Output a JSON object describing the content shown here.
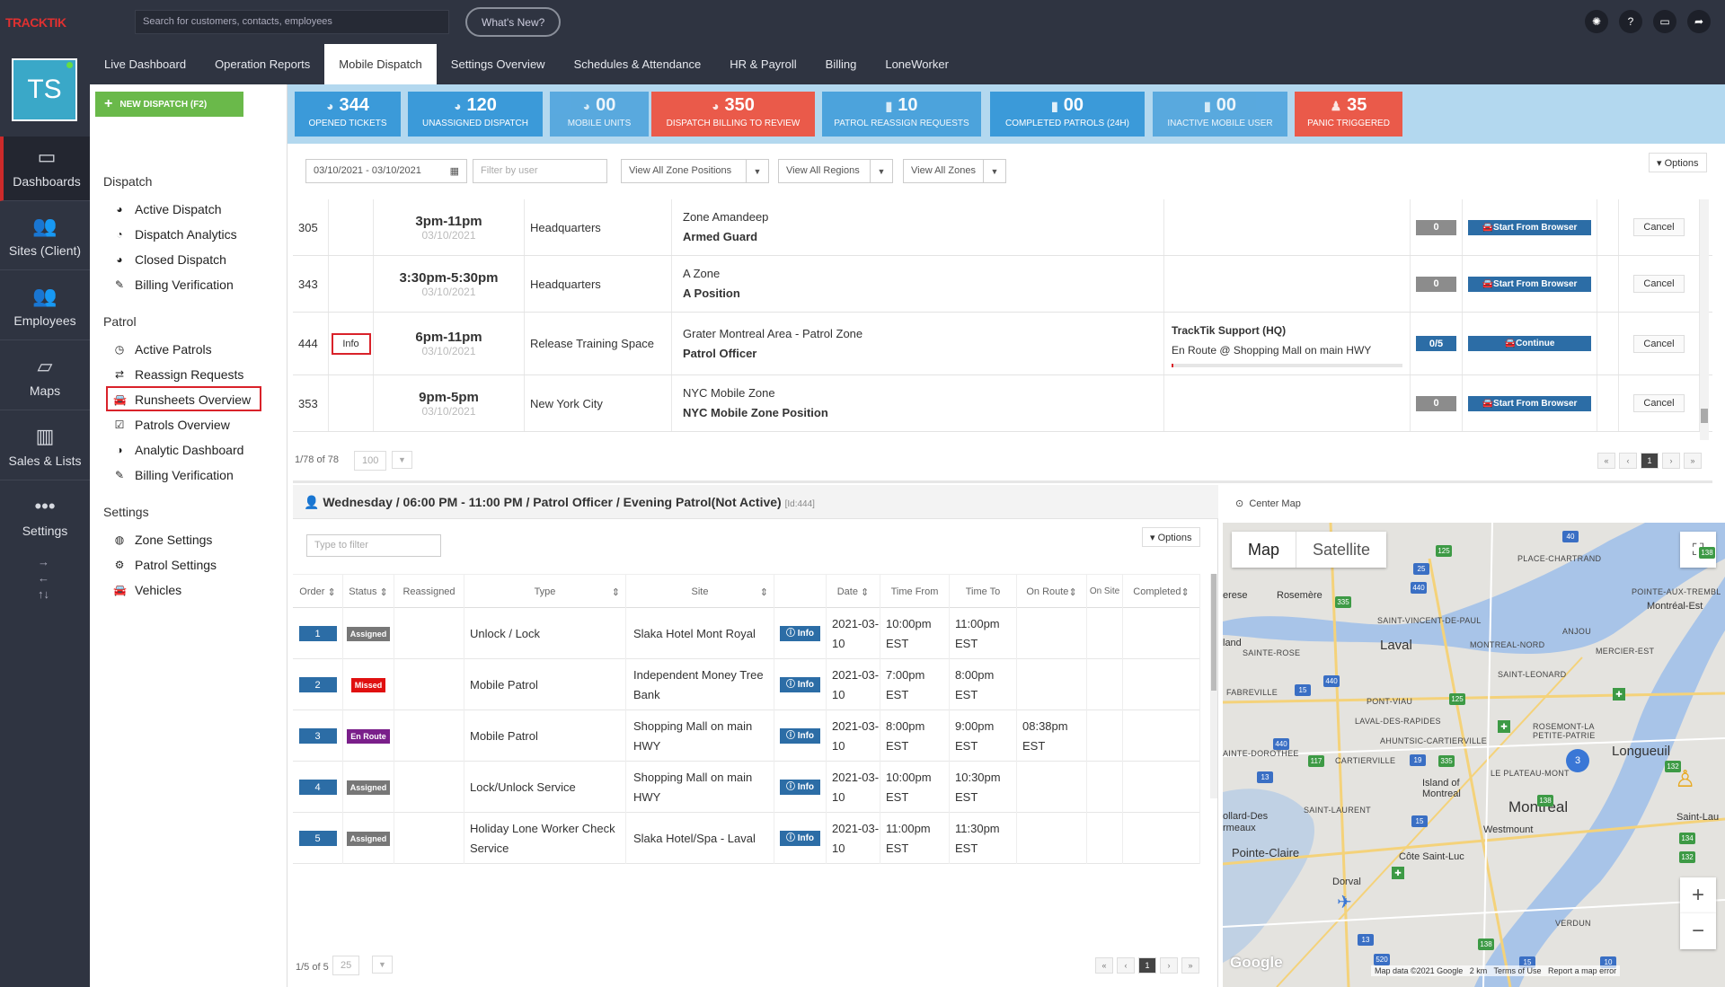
{
  "topbar": {
    "logo_a": "TRACK",
    "logo_b": "TIK",
    "search_placeholder": "Search for customers, contacts, employees",
    "whats_new": "What's New?",
    "icons": [
      "bulb-icon",
      "help-icon",
      "monitor-icon",
      "share-icon"
    ],
    "help_glyph": "?"
  },
  "nav_tabs": [
    "Live Dashboard",
    "Operation Reports",
    "Mobile Dispatch",
    "Settings Overview",
    "Schedules & Attendance",
    "HR & Payroll",
    "Billing",
    "LoneWorker"
  ],
  "active_tab": "Mobile Dispatch",
  "avatar": {
    "initials": "TS"
  },
  "left_nav": [
    {
      "label": "Dashboards",
      "icon": "monitor-icon"
    },
    {
      "label": "Sites (Client)",
      "icon": "people-icon"
    },
    {
      "label": "Employees",
      "icon": "employees-icon"
    },
    {
      "label": "Maps",
      "icon": "map-icon"
    },
    {
      "label": "Sales & Lists",
      "icon": "bar-chart-icon"
    },
    {
      "label": "Settings",
      "icon": "dots-icon"
    }
  ],
  "new_dispatch": "NEW DISPATCH (F2)",
  "sidebar": {
    "dispatch_header": "Dispatch",
    "dispatch_items": [
      "Active Dispatch",
      "Dispatch Analytics",
      "Closed Dispatch",
      "Billing Verification"
    ],
    "patrol_header": "Patrol",
    "patrol_items": [
      "Active Patrols",
      "Reassign Requests",
      "Runsheets Overview",
      "Patrols Overview",
      "Analytic Dashboard",
      "Billing Verification"
    ],
    "settings_header": "Settings",
    "settings_items": [
      "Zone Settings",
      "Patrol Settings",
      "Vehicles"
    ]
  },
  "stats": [
    {
      "value": "344",
      "label": "OPENED TICKETS",
      "color": "#3b9ad9"
    },
    {
      "value": "120",
      "label": "UNASSIGNED DISPATCH",
      "color": "#3b9ad9"
    },
    {
      "value": "00",
      "label": "MOBILE UNITS",
      "color": "#3b9ad9"
    },
    {
      "value": "350",
      "label": "DISPATCH BILLING TO REVIEW",
      "color": "#ea5a4a"
    },
    {
      "value": "10",
      "label": "PATROL REASSIGN REQUESTS",
      "color": "#3b9ad9"
    },
    {
      "value": "00",
      "label": "COMPLETED PATROLS (24H)",
      "color": "#3b9ad9"
    },
    {
      "value": "00",
      "label": "INACTIVE MOBILE USER",
      "color": "#3b9ad9"
    },
    {
      "value": "35",
      "label": "PANIC TRIGGERED",
      "color": "#ea5a4a"
    }
  ],
  "filters": {
    "date_range": "03/10/2021 - 03/10/2021",
    "user_placeholder": "Filter by user",
    "zone_positions": "View All Zone Positions",
    "regions": "View All Regions",
    "zones": "View All Zones",
    "options": "Options"
  },
  "patrols": [
    {
      "id": "305",
      "time": "3pm-11pm",
      "date": "03/10/2021",
      "site": "Headquarters",
      "zone": "Zone Amandeep",
      "position": "Armed Guard",
      "assignee": "",
      "status": "",
      "progress": "0",
      "action": "Start From Browser",
      "cancel": "Cancel"
    },
    {
      "id": "343",
      "time": "3:30pm-5:30pm",
      "date": "03/10/2021",
      "site": "Headquarters",
      "zone": "A Zone",
      "position": "A Position",
      "assignee": "",
      "status": "",
      "progress": "0",
      "action": "Start From Browser",
      "cancel": "Cancel"
    },
    {
      "id": "444",
      "info": "Info",
      "time": "6pm-11pm",
      "date": "03/10/2021",
      "site": "Release Training Space",
      "zone": "Grater Montreal Area - Patrol Zone",
      "position": "Patrol Officer",
      "assignee": "TrackTik Support (HQ)",
      "status": "En Route @ Shopping Mall on main HWY",
      "progress": "0/5",
      "action": "Continue",
      "cancel": "Cancel"
    },
    {
      "id": "353",
      "time": "9pm-5pm",
      "date": "03/10/2021",
      "site": "New York City",
      "zone": "NYC Mobile Zone",
      "position": "NYC Mobile Zone Position",
      "assignee": "",
      "status": "",
      "progress": "0",
      "action": "Start From Browser",
      "cancel": "Cancel"
    }
  ],
  "pager_top": {
    "count": "1/78 of 78",
    "per_page": "100",
    "page": "1"
  },
  "runsheet": {
    "title": "Wednesday / 06:00 PM - 11:00 PM / Patrol Officer / Evening Patrol(Not Active)",
    "id_tag": "[Id:444]",
    "filter_placeholder": "Type to filter",
    "options": "Options",
    "headers": [
      "Order",
      "Status",
      "Reassigned",
      "Type",
      "Site",
      "",
      "Date",
      "Time From",
      "Time To",
      "On Route",
      "On Site",
      "Completed"
    ],
    "rows": [
      {
        "order": "1",
        "status": "Assigned",
        "status_color": "#777777",
        "type": "Unlock / Lock",
        "site_a": "Slaka Hotel Mont Royal",
        "site_b": "",
        "info": "Info",
        "date_a": "2021-03-",
        "date_b": "10",
        "from_a": "10:00pm",
        "from_b": "EST",
        "to_a": "11:00pm",
        "to_b": "EST",
        "route_a": "",
        "route_b": ""
      },
      {
        "order": "2",
        "status": "Missed",
        "status_color": "#e01010",
        "type": "Mobile Patrol",
        "site_a": "Independent Money Tree",
        "site_b": "Bank",
        "info": "Info",
        "date_a": "2021-03-",
        "date_b": "10",
        "from_a": "7:00pm",
        "from_b": "EST",
        "to_a": "8:00pm",
        "to_b": "EST",
        "route_a": "",
        "route_b": ""
      },
      {
        "order": "3",
        "status": "En Route",
        "status_color": "#7a1f8a",
        "type": "Mobile Patrol",
        "site_a": "Shopping Mall on main",
        "site_b": "HWY",
        "info": "Info",
        "date_a": "2021-03-",
        "date_b": "10",
        "from_a": "8:00pm",
        "from_b": "EST",
        "to_a": "9:00pm",
        "to_b": "EST",
        "route_a": "08:38pm",
        "route_b": "EST"
      },
      {
        "order": "4",
        "status": "Assigned",
        "status_color": "#777777",
        "type": "Lock/Unlock Service",
        "site_a": "Shopping Mall on main",
        "site_b": "HWY",
        "info": "Info",
        "date_a": "2021-03-",
        "date_b": "10",
        "from_a": "10:00pm",
        "from_b": "EST",
        "to_a": "10:30pm",
        "to_b": "EST",
        "route_a": "",
        "route_b": ""
      },
      {
        "order": "5",
        "status": "Assigned",
        "status_color": "#777777",
        "type": "Holiday Lone Worker Check",
        "type_b": "Service",
        "site_a": "Slaka Hotel/Spa - Laval",
        "site_b": "",
        "info": "Info",
        "date_a": "2021-03-",
        "date_b": "10",
        "from_a": "11:00pm",
        "from_b": "EST",
        "to_a": "11:30pm",
        "to_b": "EST",
        "route_a": "",
        "route_b": ""
      }
    ],
    "pager": {
      "count": "1/5 of 5",
      "per_page": "25",
      "page": "1"
    }
  },
  "map": {
    "center_label": "Center Map",
    "tab_map": "Map",
    "tab_satellite": "Satellite",
    "cluster_count": "3",
    "labels_big": [
      "Laval",
      "Longueuil",
      "Montreal",
      "Pointe-Claire",
      "Rosemère",
      "Island of",
      "Montreal",
      "Côte Saint-Luc",
      "Westmount",
      "Dorval",
      "Montréal-Est",
      "Saint-Lau"
    ],
    "labels_caps": [
      "PLACE-CHARTRAND",
      "POINTE-AUX-TREMBL",
      "SAINT-VINCENT-DE-PAUL",
      "ANJOU",
      "MONTREAL-NORD",
      "MERCIER-EST",
      "SAINTE-ROSE",
      "SAINT-LEONARD",
      "FABREVILLE",
      "PONT-VIAU",
      "LAVAL-DES-RAPIDES",
      "ROSEMONT-LA PETITE-PATRIE",
      "AHUNTSIC-CARTIERVILLE",
      "AINTE-DOROTHEE",
      "CARTIERVILLE",
      "LE PLATEAU-MONT",
      "SAINT-LAURENT",
      "VERDUN"
    ],
    "labels_small": [
      "erese",
      "land",
      "ollard-Des",
      "rmeaux"
    ],
    "footer": "Map data ©2021 Google   2 km   Terms of Use   Report a map error",
    "google": "Google"
  }
}
